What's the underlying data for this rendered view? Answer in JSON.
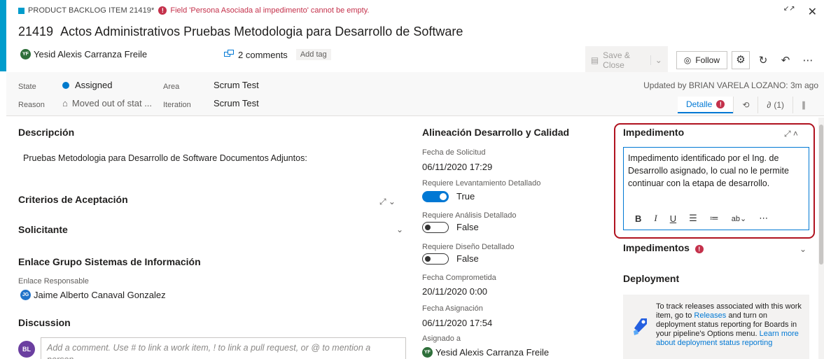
{
  "header": {
    "item_type": "PRODUCT BACKLOG ITEM 21419*",
    "error_message": "Field 'Persona Asociada al impedimento' cannot be empty.",
    "error_badge": "!",
    "id": "21419",
    "title": "Actos Administrativos Pruebas Metodologia para Desarrollo de Software",
    "assignee": {
      "initials": "YF",
      "name": "Yesid Alexis Carranza Freile"
    },
    "comments": "2 comments",
    "add_tag": "Add tag",
    "save_close": "Save & Close",
    "follow": "Follow",
    "restore_icon": "↙↗",
    "close_icon": "✕"
  },
  "fields": {
    "state_label": "State",
    "state_value": "Assigned",
    "reason_label": "Reason",
    "reason_value": "Moved out of stat ...",
    "area_label": "Area",
    "area_value": "Scrum Test",
    "iteration_label": "Iteration",
    "iteration_value": "Scrum Test",
    "updated": "Updated by BRIAN VARELA LOZANO: 3m ago"
  },
  "tabs": [
    {
      "label": "Detalle"
    },
    {
      "label": ""
    },
    {
      "label": "(1)"
    },
    {
      "label": ""
    }
  ],
  "left": {
    "descripcion_title": "Descripción",
    "descripcion_text": "Pruebas Metodologia para Desarrollo de Software Documentos Adjuntos:",
    "criterios_title": "Criterios de Aceptación",
    "solicitante_title": "Solicitante",
    "enlace_title": "Enlace Grupo Sistemas de Información",
    "enlace_label": "Enlace Responsable",
    "enlace_person": {
      "initials": "JG",
      "name": "Jaime Alberto Canaval Gonzalez"
    },
    "discussion_title": "Discussion",
    "discussion_avatar": "BL",
    "discussion_placeholder": "Add a comment. Use # to link a work item, ! to link a pull request, or @ to mention a person."
  },
  "middle": {
    "title": "Alineación Desarrollo y Calidad",
    "fecha_solicitud_label": "Fecha de Solicitud",
    "fecha_solicitud": "06/11/2020 17:29",
    "req_levantamiento_label": "Requiere Levantamiento Detallado",
    "req_levantamiento": "True",
    "req_analisis_label": "Requiere Análisis Detallado",
    "req_analisis": "False",
    "req_diseno_label": "Requiere Diseño Detallado",
    "req_diseno": "False",
    "fecha_comprometida_label": "Fecha Comprometida",
    "fecha_comprometida": "20/11/2020 0:00",
    "fecha_asignacion_label": "Fecha Asignación",
    "fecha_asignacion": "06/11/2020 17:54",
    "asignado_label": "Asignado a",
    "asignado": {
      "initials": "YF",
      "name": "Yesid Alexis Carranza Freile"
    }
  },
  "right": {
    "impedimento_title": "Impedimento",
    "impedimento_text": "Impedimento identificado por el Ing. de Desarrollo asignado, lo cual no le permite continuar con la etapa de desarrollo.",
    "impedimentos_title": "Impedimentos",
    "deployment_title": "Deployment",
    "deploy_text_1": "To track releases associated with this work item, go to ",
    "deploy_link_releases": "Releases",
    "deploy_text_2": " and turn on deployment status reporting for Boards in your pipeline's Options menu. ",
    "deploy_link_learn": "Learn more about deployment status reporting"
  },
  "colors": {
    "accent": "#009ccc",
    "error": "#c4314b",
    "link": "#0078d4",
    "highlight_frame": "#b0121f"
  }
}
